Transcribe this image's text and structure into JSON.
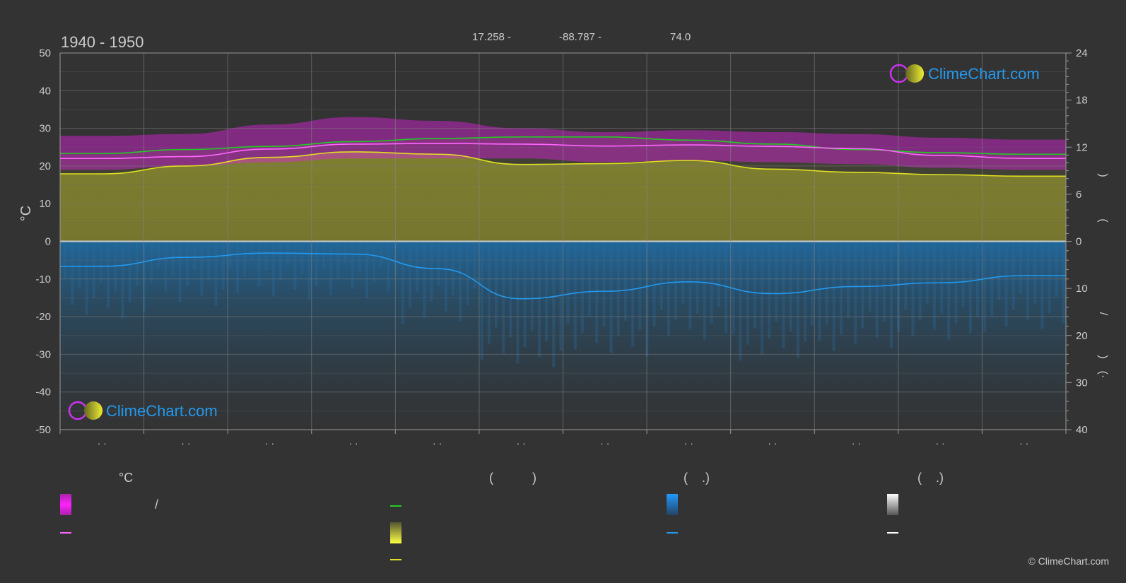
{
  "chart_data": {
    "type": "area",
    "title": "1940 - 1950",
    "subtitle_parts": [
      "17.258 -",
      "-88.787 -",
      "74.0"
    ],
    "ylabel_left": "°C",
    "ylabel_right_parts": [
      ")",
      "(",
      "/",
      ")",
      "(·"
    ],
    "left_axis": {
      "min": -50,
      "max": 50,
      "ticks": [
        50,
        40,
        30,
        20,
        10,
        0,
        -10,
        -20,
        -30,
        -40,
        -50
      ]
    },
    "right_axis_top": {
      "min": 0,
      "max": 24,
      "ticks": [
        24,
        18,
        12,
        6,
        0
      ]
    },
    "right_axis_bottom": {
      "min": 0,
      "max": 40,
      "ticks": [
        10,
        20,
        30,
        40
      ]
    },
    "month_labels": [
      "· ·",
      "· ·",
      "· ·",
      "· ·",
      "· ·",
      "· ·",
      "· ·",
      "· ·",
      "· ·",
      "· ·",
      "· ·",
      "· ·"
    ],
    "grid": true,
    "series": [
      {
        "key": "daylight",
        "color": "#22cc22",
        "type": "line",
        "axis": "right_top",
        "values": [
          11.2,
          11.7,
          12.1,
          12.7,
          13.1,
          13.3,
          13.3,
          12.9,
          12.4,
          11.7,
          11.3,
          11.1
        ]
      },
      {
        "key": "max_temp",
        "color": "#ff66ff",
        "type": "line",
        "axis": "left",
        "values": [
          22,
          22.5,
          24.5,
          25.8,
          26,
          25.8,
          25.3,
          25.6,
          25.2,
          24.6,
          22.8,
          22
        ]
      },
      {
        "key": "max_temp_band",
        "color": "#dd22dd",
        "type": "band",
        "axis": "left",
        "low": [
          19,
          20,
          21,
          22,
          22,
          22,
          21,
          21.5,
          21,
          20.5,
          19.5,
          19
        ],
        "high": [
          28,
          28.5,
          31,
          33,
          32,
          30,
          29,
          29.5,
          29,
          28.5,
          27.5,
          27
        ]
      },
      {
        "key": "sunshine",
        "color": "#e0e022",
        "type": "line",
        "axis": "right_top",
        "values": [
          8.6,
          9.6,
          10.7,
          11.4,
          11.1,
          9.8,
          9.9,
          10.3,
          9.2,
          8.8,
          8.5,
          8.3
        ]
      },
      {
        "key": "precipitation",
        "color": "#2299ee",
        "type": "line",
        "axis": "right_bottom",
        "values": [
          5.3,
          3.4,
          2.5,
          2.7,
          5.8,
          12.2,
          10.6,
          8.6,
          11.1,
          9.6,
          8.8,
          7.3
        ]
      }
    ]
  },
  "legend": {
    "header_temp": "°C",
    "header_sun": "(           )",
    "header_rain": "(    .)",
    "header_snow": "(    .)",
    "slash": "/",
    "colors": {
      "temp_swatch": "#dd22dd",
      "temp_line": "#ff66ff",
      "daylight_line": "#22cc22",
      "sun_swatch": "#e0e022",
      "sun_line": "#e0e022",
      "rain_swatch": "#2299ee",
      "rain_line": "#2299ee",
      "snow_swatch": "#dddddd",
      "snow_line": "#ffffff"
    }
  },
  "logo": {
    "text": "ClimeChart.com"
  },
  "copyright": "© ClimeChart.com"
}
